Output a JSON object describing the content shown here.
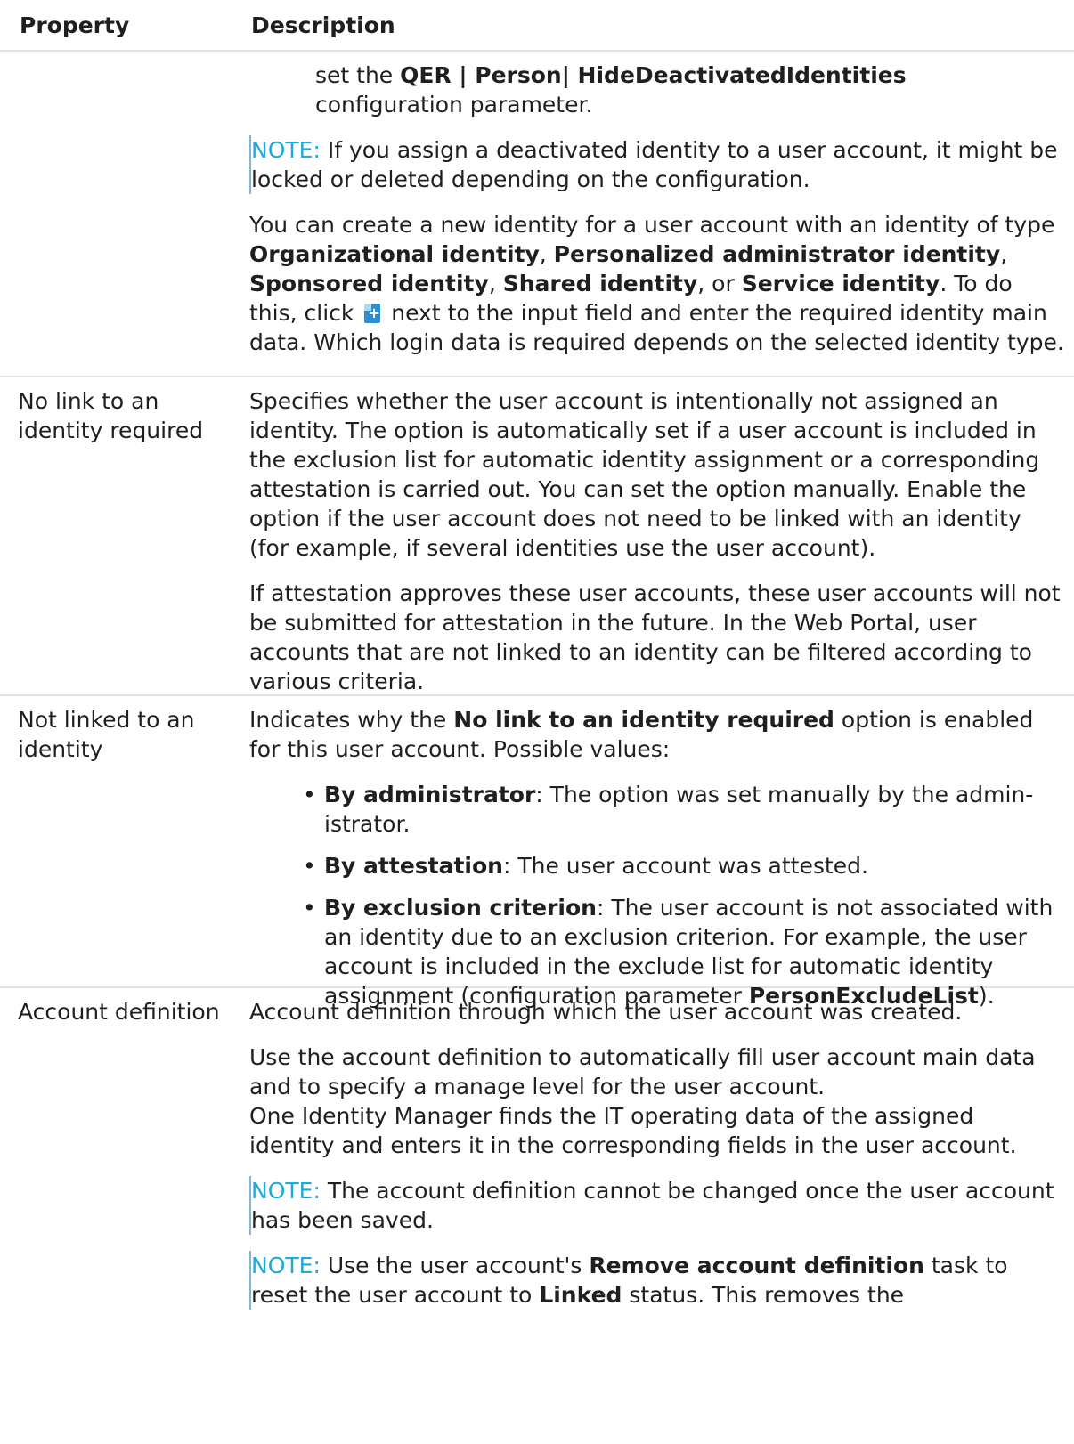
{
  "header": {
    "property": "Property",
    "description": "Description"
  },
  "row1": {
    "cont_pre": "set the ",
    "cont_bold": "QER | Person| HideDeactivatedIdentities",
    "cont_post": "configuration parameter.",
    "note_label": "NOTE:",
    "note_text": " If you assign a deactivated identity to a user account, it might be locked or deleted depending on the configuration.",
    "p_a": "You can create a new identity for a user account with an identity of type ",
    "b1": "Organizational identity",
    "s1": ", ",
    "b2": "Personalized administrator identity",
    "s2": ", ",
    "b3": "Sponsored identity",
    "s3": ", ",
    "b4": "Shared identity",
    "s4": ", or ",
    "b5": "Service identity",
    "p_b": ". To do this, click ",
    "icon": "add-identity-icon",
    "p_c": " next to the input field and enter the required identity main data. Which login data is required depends on the selected identity type."
  },
  "row2": {
    "property": "No link to an identity required",
    "p1": "Specifies whether the user account is intentionally not assigned an identity. The option is automatically set if a user account is included in the exclusion list for automatic identity assignment or a corresponding attestation is carried out. You can set the option manually. Enable the option if the user account does not need to be linked with an identity (for example, if several identities use the user account).",
    "p2": "If attestation approves these user accounts, these user accounts will not be submitted for attestation in the future. In the Web Portal, user accounts that are not linked to an identity can be filtered according to various criteria."
  },
  "row3": {
    "property": "Not linked to an identity",
    "p_pre": "Indicates why the ",
    "p_bold": "No link to an identity required",
    "p_post": " option is enabled for this user account. Possible values:",
    "items": [
      {
        "bold": "By administrator",
        "text": ": The option was set manually by the admin-istrator."
      },
      {
        "bold": "By attestation",
        "text": ": The user account was attested."
      },
      {
        "bold": "By exclusion criterion",
        "text": ": The user account is not associated with an identity due to an exclusion criterion. For example, the user account is included in the exclude list for automatic identity assignment (configuration parameter ",
        "bold2": "PersonExcludeList",
        "text2": ")."
      }
    ]
  },
  "row4": {
    "property": "Account definition",
    "p1": "Account definition through which the user account was created.",
    "p2": "Use the account definition to automatically fill user account main data and to specify a manage level for the user account.",
    "p3": "One Identity Manager finds the IT operating data of the assigned identity and enters it in the corresponding fields in the user account.",
    "note1_label": "NOTE:",
    "note1_text": " The account definition cannot be changed once the user account has been saved.",
    "note2_label": "NOTE:",
    "note2_pre": " Use the user account's ",
    "note2_bold1": "Remove account definition",
    "note2_mid": " task to reset the user account to ",
    "note2_bold2": "Linked",
    "note2_post": " status. This removes the"
  }
}
